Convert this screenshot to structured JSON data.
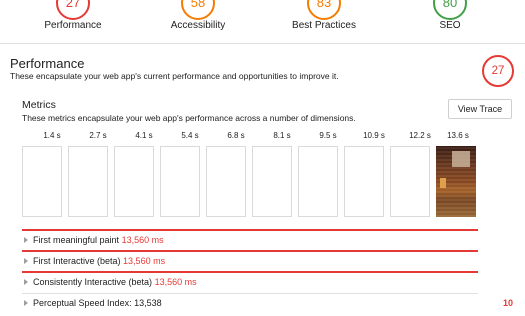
{
  "gauges": [
    {
      "score": "27",
      "label": "Performance",
      "color": "#e53935"
    },
    {
      "score": "58",
      "label": "Accessibility",
      "color": "#f57c00"
    },
    {
      "score": "83",
      "label": "Best Practices",
      "color": "#f57c00"
    },
    {
      "score": "80",
      "label": "SEO",
      "color": "#43a047"
    }
  ],
  "category": {
    "title": "Performance",
    "description": "These encapsulate your web app's current performance and opportunities to improve it.",
    "score": "27"
  },
  "metrics": {
    "title": "Metrics",
    "description": "These metrics encapsulate your web app's performance across a number of dimensions.",
    "view_trace_label": "View Trace",
    "timeline": [
      "1.4 s",
      "2.7 s",
      "4.1 s",
      "5.4 s",
      "6.8 s",
      "8.1 s",
      "9.5 s",
      "10.9 s",
      "12.2 s",
      "13.6 s"
    ],
    "rows": [
      {
        "label": "First meaningful paint",
        "value": "13,560 ms"
      },
      {
        "label": "First Interactive (beta)",
        "value": "13,560 ms"
      },
      {
        "label": "Consistently Interactive (beta)",
        "value": "13,560 ms"
      },
      {
        "label": "Perceptual Speed Index:",
        "value": "13,538",
        "score": "10"
      }
    ]
  }
}
